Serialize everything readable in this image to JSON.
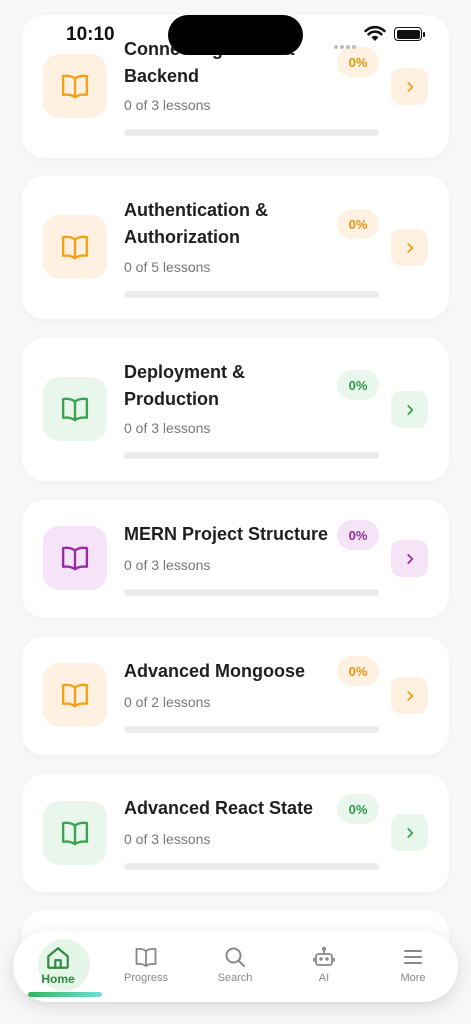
{
  "status_bar": {
    "time": "10:10"
  },
  "courses": [
    {
      "title": "Connecting React & Backend",
      "lessons": "0 of 3 lessons",
      "percent": "0%",
      "progress": 0,
      "theme": "orange",
      "icon": "book-icon"
    },
    {
      "title": "Authentication & Authorization",
      "lessons": "0 of 5 lessons",
      "percent": "0%",
      "progress": 0,
      "theme": "orange",
      "icon": "book-icon"
    },
    {
      "title": "Deployment & Production",
      "lessons": "0 of 3 lessons",
      "percent": "0%",
      "progress": 0,
      "theme": "green",
      "icon": "book-icon"
    },
    {
      "title": "MERN Project Structure",
      "lessons": "0 of 3 lessons",
      "percent": "0%",
      "progress": 0,
      "theme": "purple",
      "icon": "book-icon"
    },
    {
      "title": "Advanced Mongoose",
      "lessons": "0 of 2 lessons",
      "percent": "0%",
      "progress": 0,
      "theme": "orange",
      "icon": "book-icon"
    },
    {
      "title": "Advanced React State",
      "lessons": "0 of 3 lessons",
      "percent": "0%",
      "progress": 0,
      "theme": "green",
      "icon": "book-icon"
    }
  ],
  "themes": {
    "orange": {
      "bg": "#fff1e1",
      "fg": "#f5a01a",
      "badge_bg": "#fff1e1",
      "badge_fg": "#e8960f"
    },
    "green": {
      "bg": "#e9f6eb",
      "fg": "#3aa34f",
      "badge_bg": "#e9f6eb",
      "badge_fg": "#2f9a45"
    },
    "purple": {
      "bg": "#f5e4f7",
      "fg": "#9b2aa8",
      "badge_bg": "#f5e4f7",
      "badge_fg": "#8f2a9e"
    }
  },
  "tabbar": {
    "tabs": [
      {
        "label": "Home",
        "icon": "home-icon",
        "active": true
      },
      {
        "label": "Progress",
        "icon": "book-icon",
        "active": false
      },
      {
        "label": "Search",
        "icon": "search-icon",
        "active": false
      },
      {
        "label": "AI",
        "icon": "robot-icon",
        "active": false
      },
      {
        "label": "More",
        "icon": "menu-icon",
        "active": false
      }
    ],
    "active_color": "#2e8b3e",
    "inactive_color": "#888888"
  }
}
